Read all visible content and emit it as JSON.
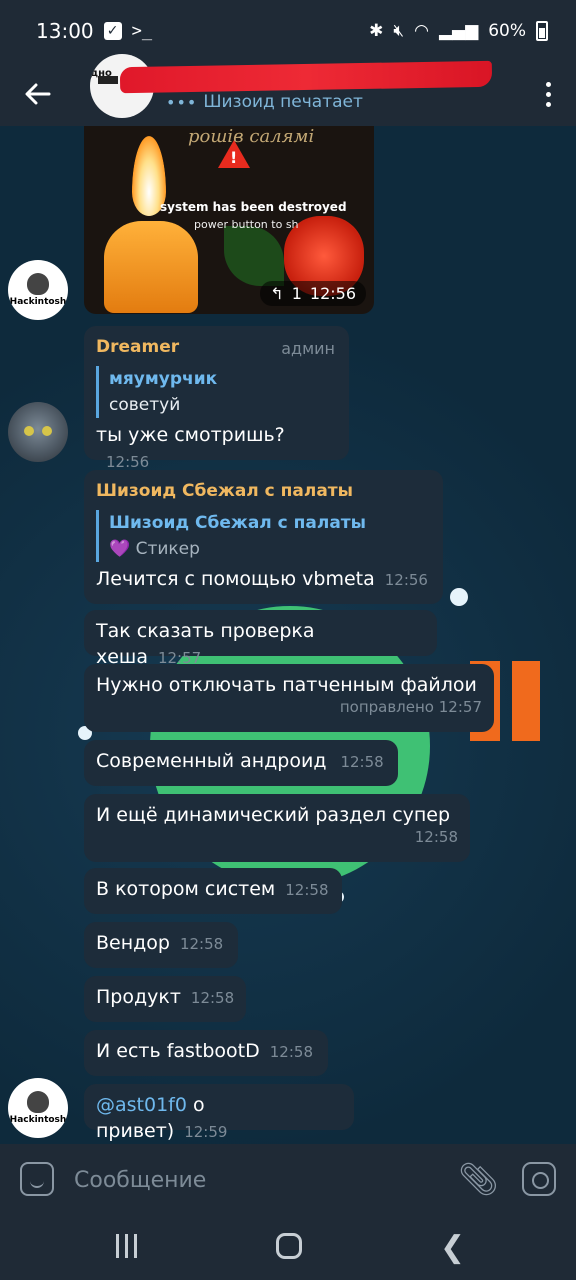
{
  "status_bar": {
    "time": "13:00",
    "battery": "60%"
  },
  "header": {
    "avatar_text": "дно",
    "status_text": "Шизоид печатает"
  },
  "photo_message": {
    "caption_top": "рошів салямі",
    "caption_mid": "system has been destroyed",
    "caption_mid2": "power button to sh",
    "reply_count": "1",
    "time": "12:56"
  },
  "avatars": {
    "hackintosh_label": "Hackintosh"
  },
  "messages": {
    "m1": {
      "sender": "Dreamer",
      "role": "админ",
      "reply_name": "мяумурчик",
      "reply_text": "советуй",
      "text": "ты уже смотришь?",
      "time": "12:56"
    },
    "m2": {
      "sender": "Шизоид Сбежал с палаты",
      "reply_name": "Шизоид Сбежал с палаты",
      "reply_heart": "💜",
      "reply_text": "Стикер",
      "text": "Лечится с помощью vbmeta",
      "time": "12:56"
    },
    "m3": {
      "text": "Так сказать проверка хеша",
      "time": "12:57"
    },
    "m4": {
      "text": "Нужно отключать патченным файлои",
      "edited": "поправлено",
      "time": "12:57"
    },
    "m5": {
      "text": "Современный андроид",
      "time": "12:58"
    },
    "m6": {
      "text": "И ещё динамический раздел супер",
      "time": "12:58"
    },
    "m7": {
      "text": "В котором систем",
      "time": "12:58"
    },
    "m8": {
      "text": "Вендор",
      "time": "12:58"
    },
    "m9": {
      "text": "Продукт",
      "time": "12:58"
    },
    "m10": {
      "text": "И есть fastbootD",
      "time": "12:58"
    },
    "m11": {
      "mention": "@ast01f0",
      "text": " о привет)",
      "time": "12:59"
    }
  },
  "input": {
    "placeholder": "Сообщение"
  },
  "colors": {
    "accent": "#6fb9ee",
    "sender_name": "#f0b860",
    "bubble": "#1d2c3a",
    "redaction": "#e0182a"
  }
}
